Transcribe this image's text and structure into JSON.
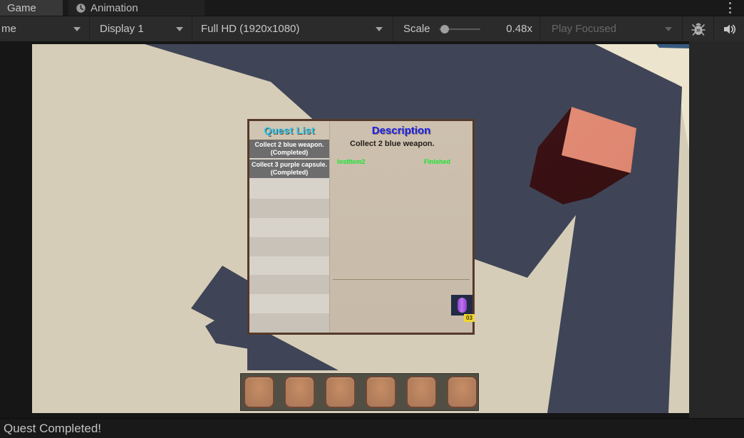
{
  "tab_bar": {
    "tabs": [
      {
        "label": "Game",
        "active": true
      },
      {
        "label": "Animation",
        "active": false,
        "icon": "clock-icon"
      }
    ],
    "menu_icon": "kebab-menu"
  },
  "toolbar": {
    "target_dropdown": "me",
    "display_dropdown": "Display 1",
    "resolution_dropdown": "Full HD (1920x1080)",
    "scale_label": "Scale",
    "scale_value": "0.48x",
    "scale_fraction": 0.15,
    "play_focused_dropdown": "Play Focused",
    "play_focused_disabled": true,
    "icons": [
      "bug-icon",
      "audio-icon"
    ]
  },
  "game": {
    "quest_panel": {
      "list_title": "Quest List",
      "quests": [
        {
          "line1": "Collect 2 blue weapon.",
          "line2": "(Completed)"
        },
        {
          "line1": "Collect 3 purple capsule.",
          "line2": "(Completed)"
        }
      ],
      "empty_rows": 8,
      "description_title": "Description",
      "description_text": "Collect 2 blue weapon.",
      "goal_item": "lostItem2",
      "goal_status": "Finished",
      "item_icon": "purple-capsule-icon",
      "item_count": "03"
    },
    "hotbar": {
      "slot_count": 6
    },
    "scene_objects": [
      "red-cube",
      "floor-shadows"
    ]
  },
  "status_bar": {
    "message": "Quest Completed!"
  },
  "colors": {
    "floor": "#d6cdb8",
    "shadow": "#3f4557",
    "cube_top": "#e99179",
    "cube_side": "#361013",
    "quest_title": "#2cc7f2",
    "description_title": "#1b20ea",
    "goal_text": "#15e62e",
    "count_badge": "#efd62f",
    "slot_brown": "#b47f5c"
  }
}
